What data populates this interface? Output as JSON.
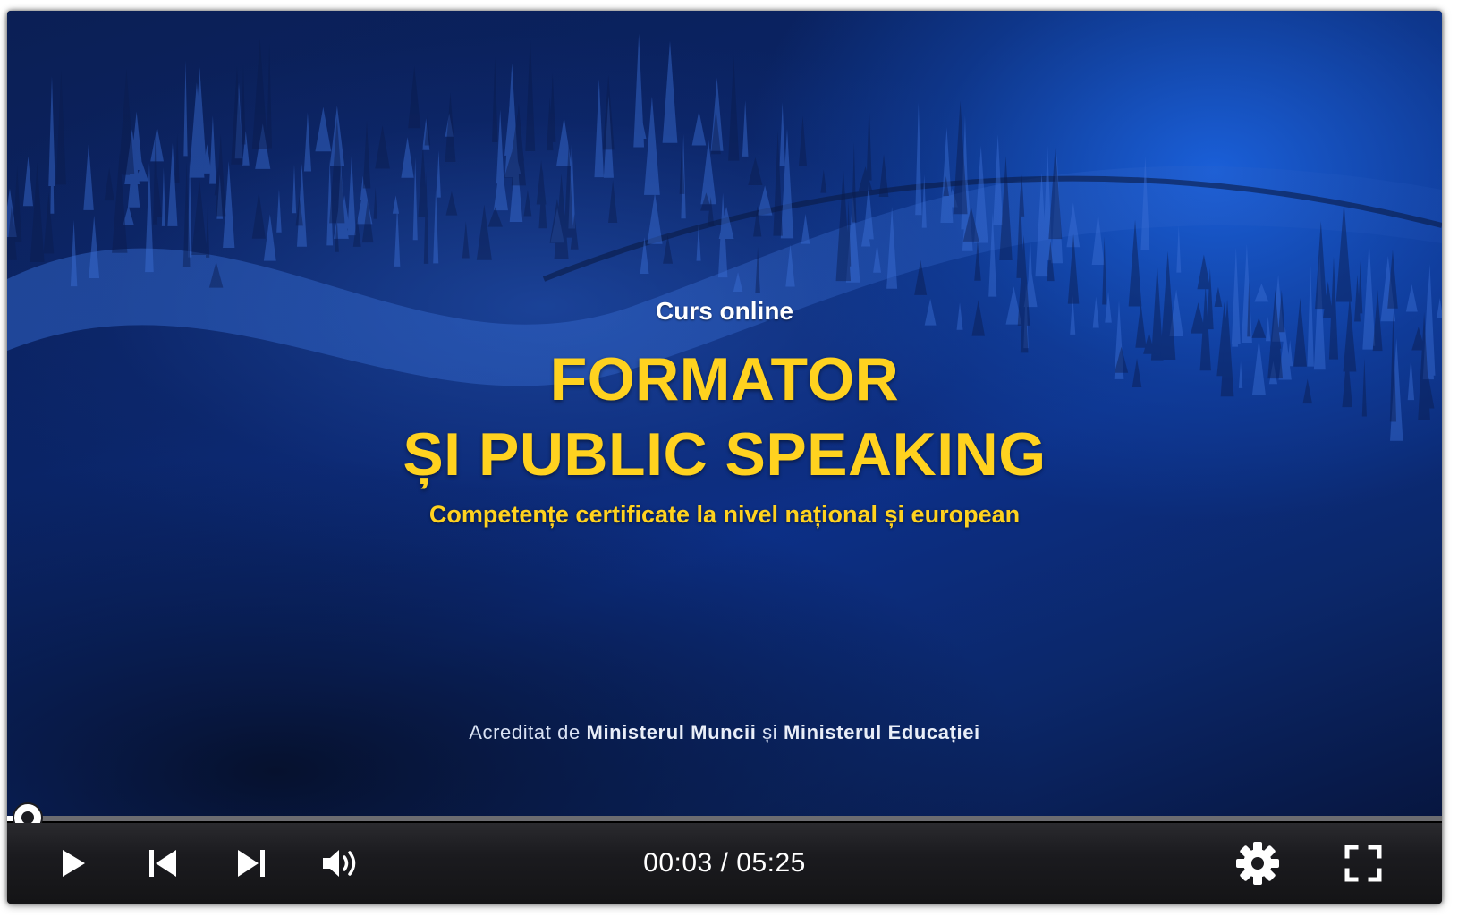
{
  "video": {
    "kicker": "Curs online",
    "headline_line1": "FORMATOR",
    "headline_line2": "ȘI PUBLIC SPEAKING",
    "subtitle": "Competențe certificate la nivel național și european",
    "accreditation": {
      "prefix": "Acreditat de",
      "org1": "Ministerul Muncii",
      "joiner": "și",
      "org2": "Ministerul Educației"
    }
  },
  "player": {
    "current_time": "00:03",
    "separator": "/",
    "duration": "05:25",
    "progress_fraction": 0.0095,
    "colors": {
      "headline": "#ffd21f",
      "control_bar": "#1b1b1f",
      "progress_track": "#6c6c70",
      "progress_fill": "#ffffff"
    },
    "icons": {
      "play": "play-icon",
      "previous": "skip-previous-icon",
      "next": "skip-next-icon",
      "volume": "volume-icon",
      "settings": "gear-icon",
      "fullscreen": "fullscreen-icon"
    }
  }
}
